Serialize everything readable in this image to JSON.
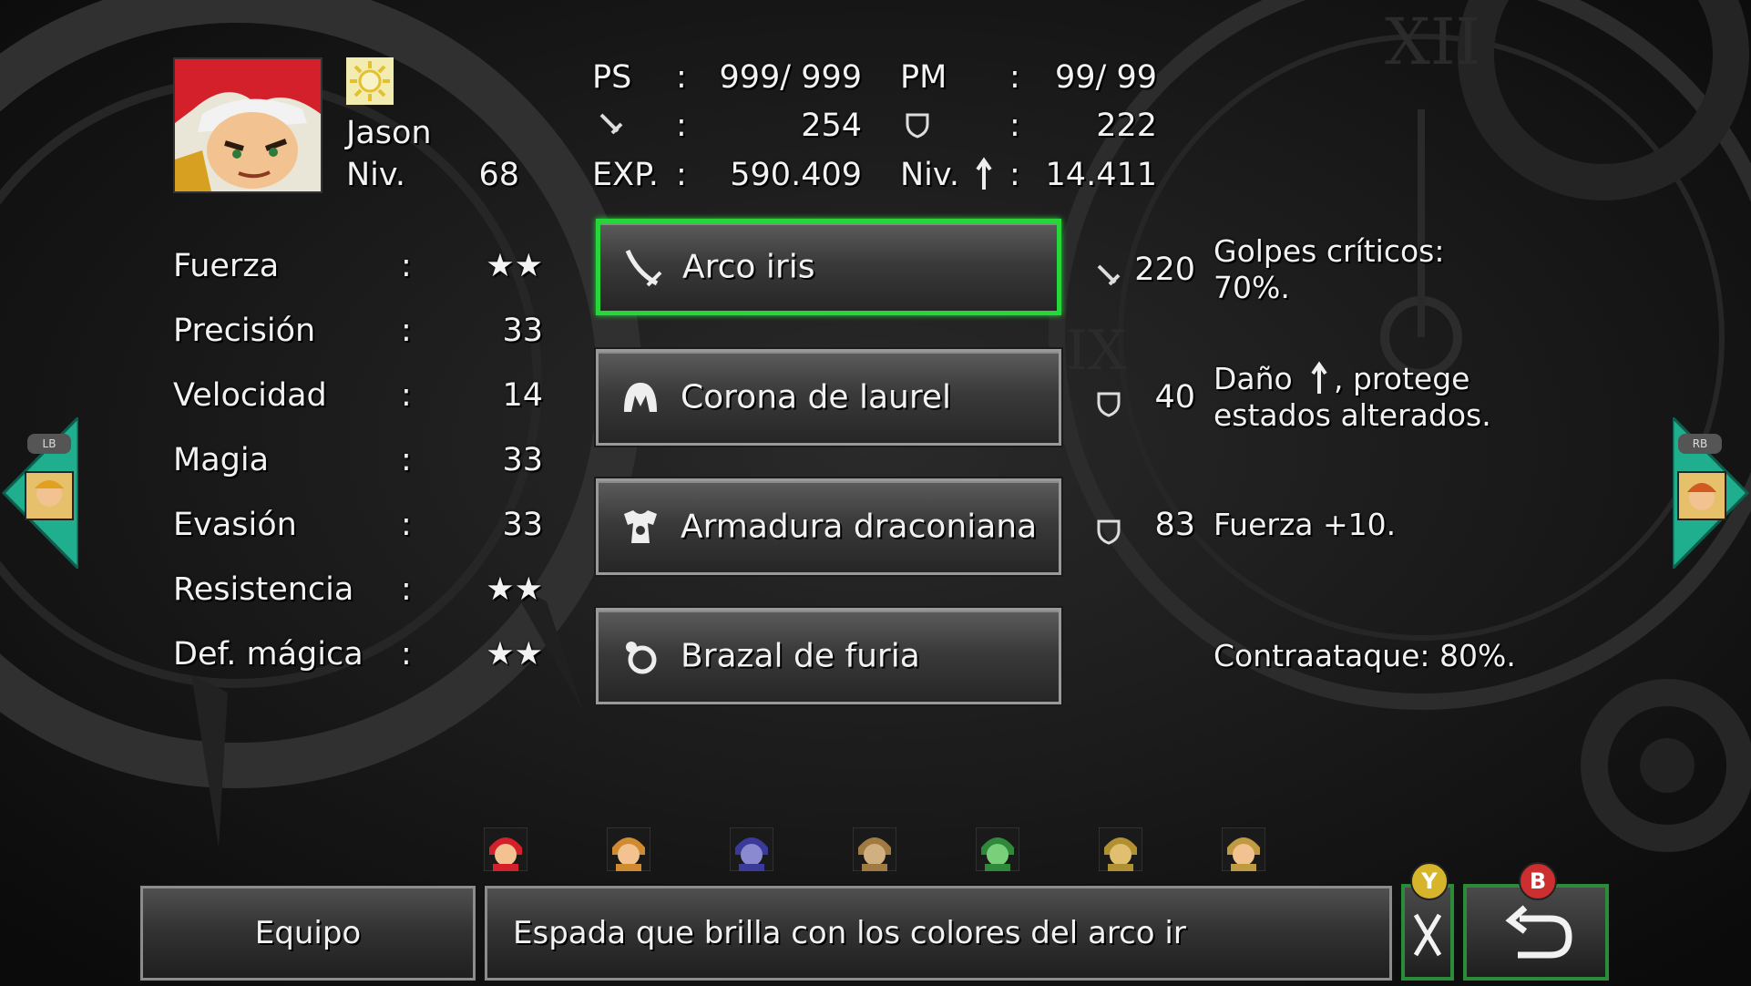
{
  "character": {
    "name": "Jason",
    "level_label": "Niv.",
    "level": "68",
    "portrait_icon": "crono-portrait",
    "element_icon": "light-element-icon"
  },
  "vitals": {
    "ps_label": "PS",
    "ps_value": "999/ 999",
    "pm_label": "PM",
    "pm_value": "99/ 99",
    "attack_value": "254",
    "defense_value": "222",
    "exp_label": "EXP.",
    "exp_value": "590.409",
    "next_label": "Niv.",
    "next_value": "14.411",
    "colon": ":"
  },
  "stats": [
    {
      "label": "Fuerza",
      "value": "★★"
    },
    {
      "label": "Precisión",
      "value": "33"
    },
    {
      "label": "Velocidad",
      "value": "14"
    },
    {
      "label": "Magia",
      "value": "33"
    },
    {
      "label": "Evasión",
      "value": "33"
    },
    {
      "label": "Resistencia",
      "value": "★★"
    },
    {
      "label": "Def. mágica",
      "value": "★★"
    }
  ],
  "equipment": [
    {
      "name": "Arco iris",
      "icon": "sword-icon",
      "stat_icon": "attack-icon",
      "stat_value": "220",
      "effect_line1": "Golpes críticos:",
      "effect_line2": "70%.",
      "selected": true
    },
    {
      "name": "Corona de laurel",
      "icon": "helmet-icon",
      "stat_icon": "defense-icon",
      "stat_value": "40",
      "effect_line1": "Daño",
      "effect_line1b": ", protege",
      "effect_line2": "estados alterados.",
      "selected": false
    },
    {
      "name": "Armadura draconiana",
      "icon": "armor-icon",
      "stat_icon": "defense-icon",
      "stat_value": "83",
      "effect_line1": "Fuerza +10.",
      "effect_line2": "",
      "selected": false
    },
    {
      "name": "Brazal de furia",
      "icon": "accessory-icon",
      "stat_icon": "",
      "stat_value": "",
      "effect_line1": "Contraataque: 80%.",
      "effect_line2": "",
      "selected": false
    }
  ],
  "party": [
    "crono",
    "marle",
    "magus",
    "robo",
    "frog",
    "ayla",
    "lucca"
  ],
  "bottom": {
    "menu_label": "Equipo",
    "description": "Espada que brilla con los colores del arco ir",
    "y_badge": "Y",
    "b_badge": "B",
    "lb_label": "LB",
    "rb_label": "RB"
  },
  "colors": {
    "select": "#27d63a",
    "arrow": "#1faf8e",
    "y_badge": "#d6b52a",
    "b_badge": "#cc2f2f"
  }
}
